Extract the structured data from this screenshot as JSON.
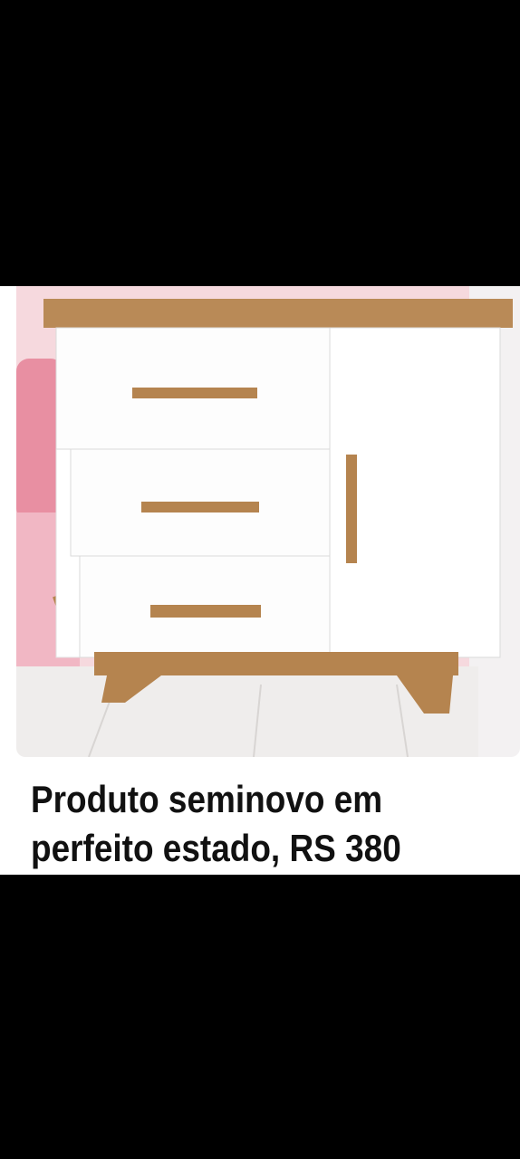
{
  "post": {
    "caption_line_1": "Produto seminovo em",
    "caption_line_2": "perfeito estado, RS 380"
  },
  "colors": {
    "background": "#000000",
    "wall_pink": "#f3c6cf",
    "wood": "#b5844f",
    "cabinet_white": "#ffffff",
    "floor": "#eceae8"
  },
  "photo": {
    "subject": "white-dresser-with-wooden-handles"
  }
}
